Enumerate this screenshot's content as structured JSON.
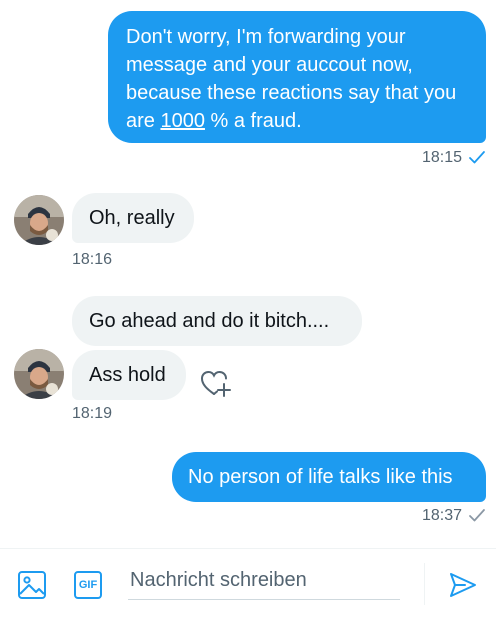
{
  "messages": [
    {
      "direction": "outgoing",
      "text_parts": [
        "Don't worry, I'm forwarding your message and your auccout now, because these reactions say that you are ",
        "1000",
        " % a fraud."
      ],
      "time": "18:15",
      "read": true
    },
    {
      "direction": "incoming",
      "text": "Oh, really",
      "time": "18:16"
    },
    {
      "direction": "incoming",
      "text": "Go ahead and do it bitch...."
    },
    {
      "direction": "incoming",
      "text": "Ass hold",
      "time": "18:19"
    },
    {
      "direction": "outgoing",
      "text": "No person of life talks like this",
      "time": "18:37",
      "read": false
    }
  ],
  "composer": {
    "placeholder": "Nachricht schreiben",
    "gif_label": "GIF",
    "icons": [
      "image-icon",
      "gif-icon",
      "send-icon"
    ]
  },
  "colors": {
    "accent": "#1d9bf0",
    "incoming_bg": "#eff3f4",
    "meta_text": "#536471"
  }
}
